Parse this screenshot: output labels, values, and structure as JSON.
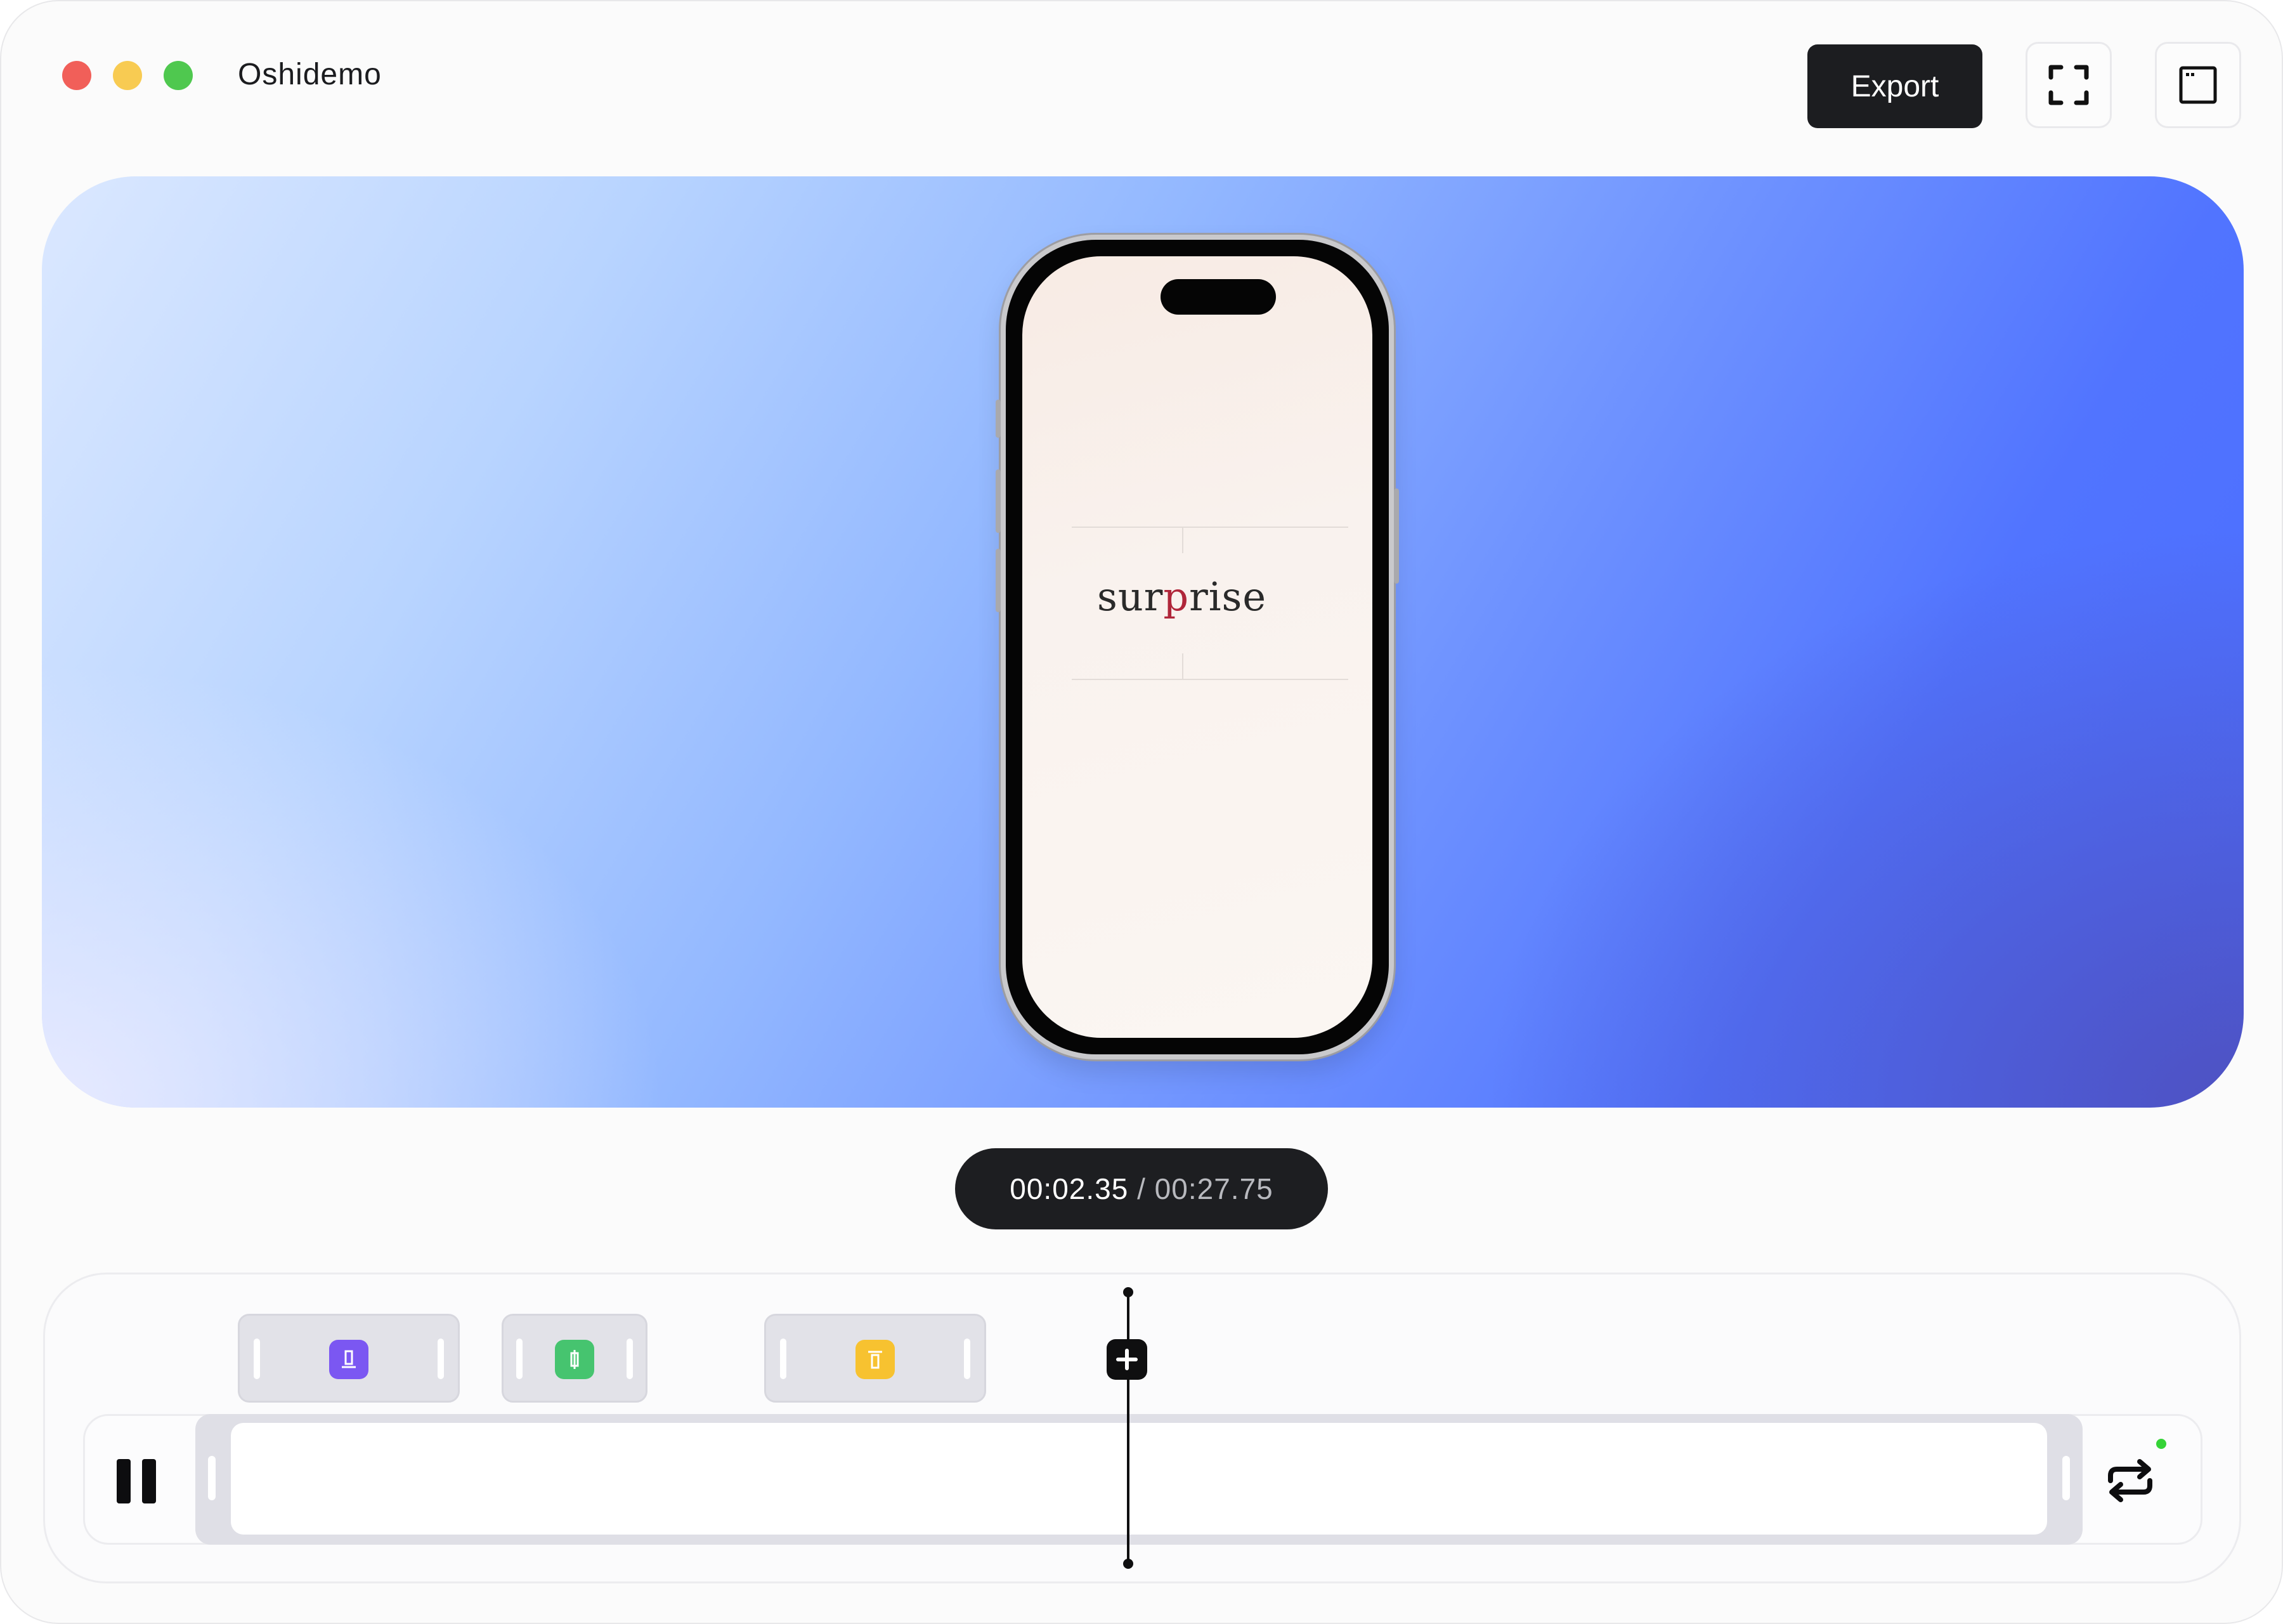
{
  "window": {
    "title": "Oshidemo",
    "controls": [
      "close",
      "minimize",
      "zoom"
    ]
  },
  "toolbar": {
    "export_label": "Export",
    "fullscreen_icon": "fullscreen-icon",
    "window_icon": "window-icon"
  },
  "preview": {
    "device": "phone",
    "screen_word_before": "sur",
    "screen_word_highlight": "p",
    "screen_word_after": "rise",
    "highlight_color": "#b0263a"
  },
  "playback": {
    "current_time": "00:02.35",
    "separator": "/",
    "total_time": "00:27.75"
  },
  "timeline": {
    "clips": [
      {
        "icon": "text-bottom-icon",
        "color": "#7b57f2"
      },
      {
        "icon": "text-center-icon",
        "color": "#46c46f"
      },
      {
        "icon": "text-top-icon",
        "color": "#f7c230"
      }
    ],
    "play_state": "playing",
    "loop_enabled": true,
    "loop_status_color": "#35d337"
  }
}
